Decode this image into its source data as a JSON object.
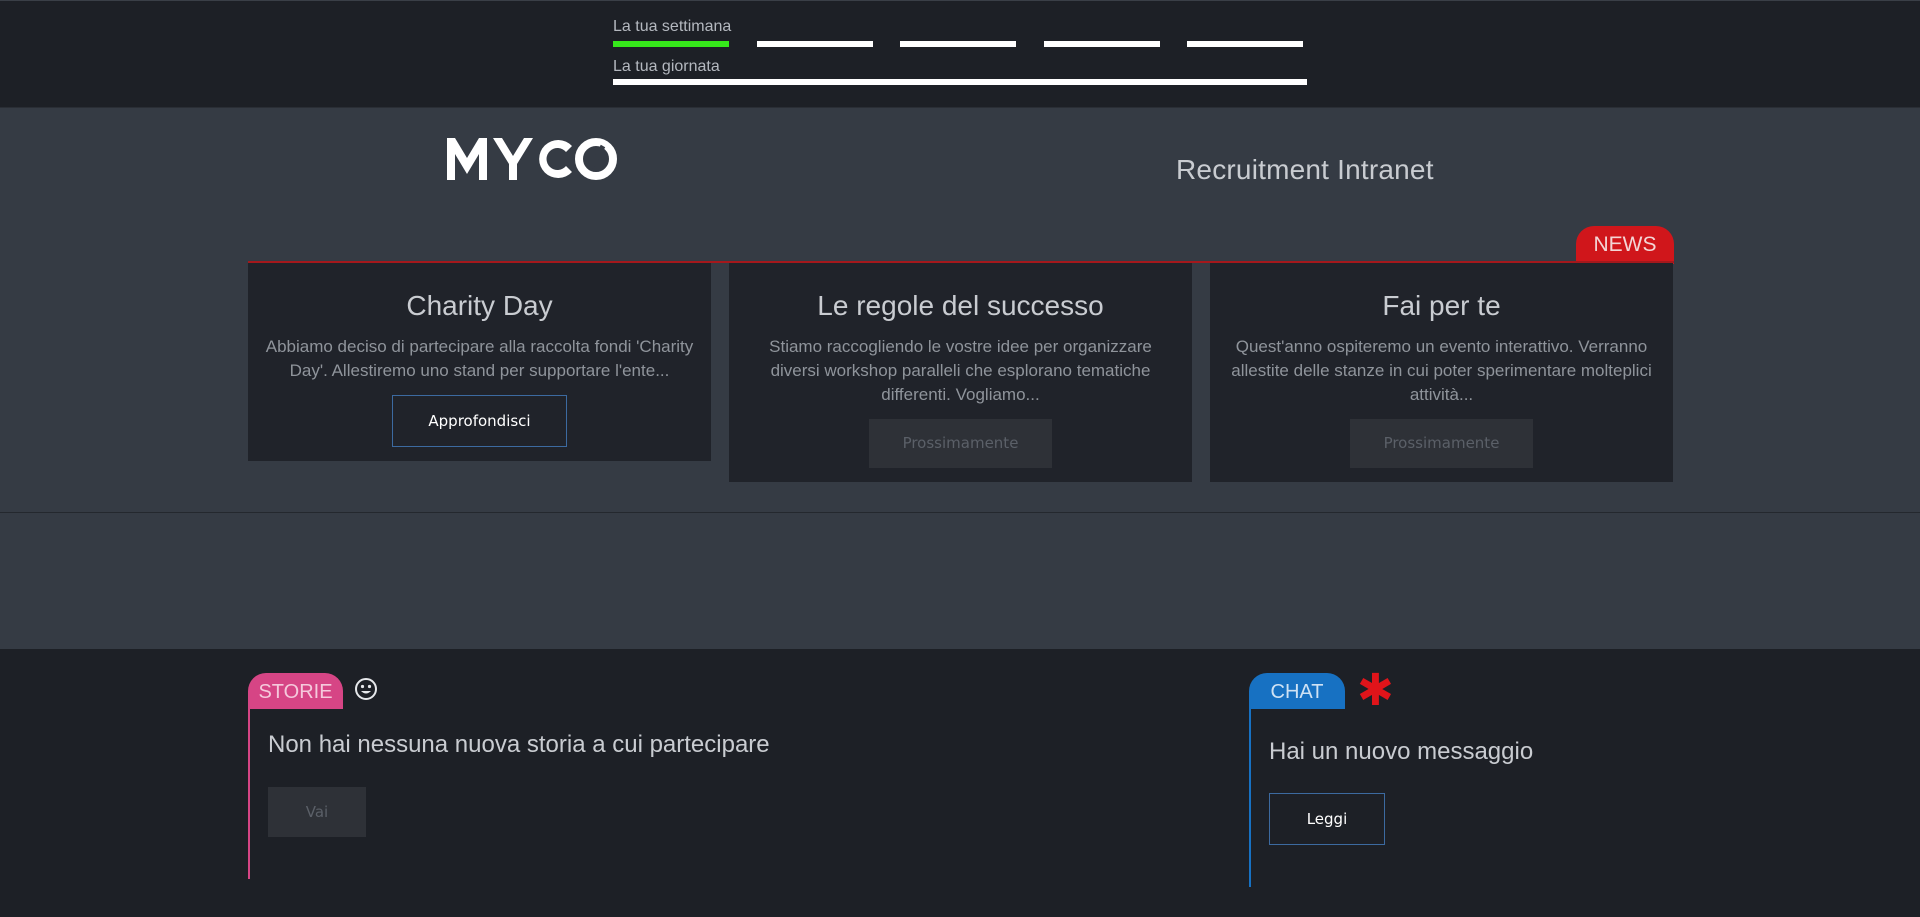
{
  "progress": {
    "week_label": "La tua settimana",
    "week_segments": [
      {
        "day": 1,
        "completed": true
      },
      {
        "day": 2,
        "completed": false
      },
      {
        "day": 3,
        "completed": false
      },
      {
        "day": 4,
        "completed": false
      },
      {
        "day": 5,
        "completed": false
      }
    ],
    "day_label": "La tua giornata",
    "day_progress": 0,
    "colors": {
      "done": "#36e81b",
      "pending": "#ffffff"
    }
  },
  "header": {
    "logo_text": "MYCO",
    "site_title": "Recruitment Intranet"
  },
  "news": {
    "badge_label": "NEWS",
    "badge_color": "#d0161b",
    "cards": [
      {
        "title": "Charity Day",
        "text": "Abbiamo deciso di partecipare alla raccolta fondi 'Charity Day'. Allestiremo uno stand per supportare l'ente...",
        "button_label": "Approfondisci",
        "button_enabled": true
      },
      {
        "title": "Le regole del successo",
        "text": "Stiamo raccogliendo le vostre idee per organizzare diversi workshop paralleli che esplorano tematiche differenti. Vogliamo...",
        "button_label": "Prossimamente",
        "button_enabled": false
      },
      {
        "title": "Fai per te",
        "text": "Quest'anno ospiteremo un evento interattivo. Verranno allestite delle stanze in cui poter sperimentare molteplici attività...",
        "button_label": "Prossimamente",
        "button_enabled": false
      }
    ]
  },
  "stories": {
    "tab_label": "STORIE",
    "tab_color": "#d64585",
    "icon": "smiley-icon",
    "message": "Non hai nessuna nuova storia a cui partecipare",
    "button_label": "Vai",
    "button_enabled": false
  },
  "chat": {
    "tab_label": "CHAT",
    "tab_color": "#1771c2",
    "icon": "asterisk-icon",
    "message": "Hai un nuovo messaggio",
    "button_label": "Leggi",
    "button_enabled": true
  }
}
